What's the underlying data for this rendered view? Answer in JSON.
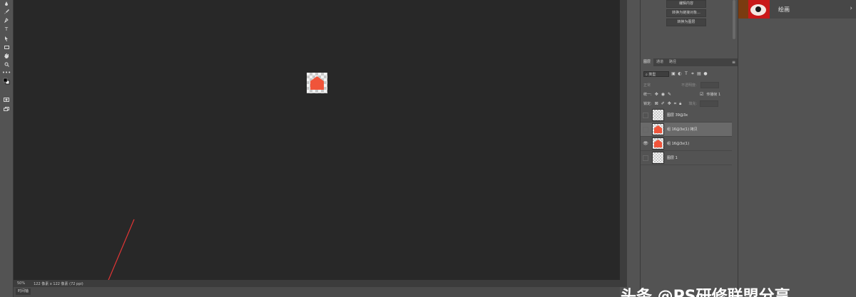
{
  "toolbar": {
    "icons": [
      "eyedropper-icon",
      "brush-icon",
      "pen-icon",
      "type-icon",
      "path-select-icon",
      "rectangle-icon",
      "hand-icon",
      "zoom-icon",
      "more-tools-icon",
      "color-swatches-icon",
      "quick-mask-icon",
      "screen-mode-icon"
    ]
  },
  "canvas": {
    "background": "#282828"
  },
  "statusbar": {
    "zoom": "50%",
    "doc_info": "122 像素 x 122 像素 (72 ppi)"
  },
  "timeline": {
    "label": "时间轴"
  },
  "properties": {
    "buttons": [
      "编辑内容",
      "转换为链接对象...",
      "转换为图层"
    ]
  },
  "layers_panel": {
    "tabs": [
      "图层",
      "通道",
      "路径"
    ],
    "filter_label": "类型",
    "blend_mode": "正常",
    "opacity_label": "不透明度:",
    "unify_label": "统一:",
    "propagate_label": "传播帧 1",
    "lock_label": "锁定:",
    "fill_label": "填充:",
    "layers": [
      {
        "name": "图层 39@3x",
        "visible": false,
        "selected": false,
        "thumb": "checker"
      },
      {
        "name": "组 16@3x(1) 拷贝",
        "visible": false,
        "selected": true,
        "thumb": "shape"
      },
      {
        "name": "组 16@3x(1)",
        "visible": true,
        "selected": false,
        "thumb": "shape"
      },
      {
        "name": "图层 1",
        "visible": false,
        "selected": false,
        "thumb": "checker"
      }
    ]
  },
  "history": {
    "label": "绘画"
  },
  "colors": {
    "accent": "#f0543a",
    "selected_row": "#6a6a6a"
  },
  "watermark": {
    "text": "头条 @PS研修联盟分享"
  }
}
